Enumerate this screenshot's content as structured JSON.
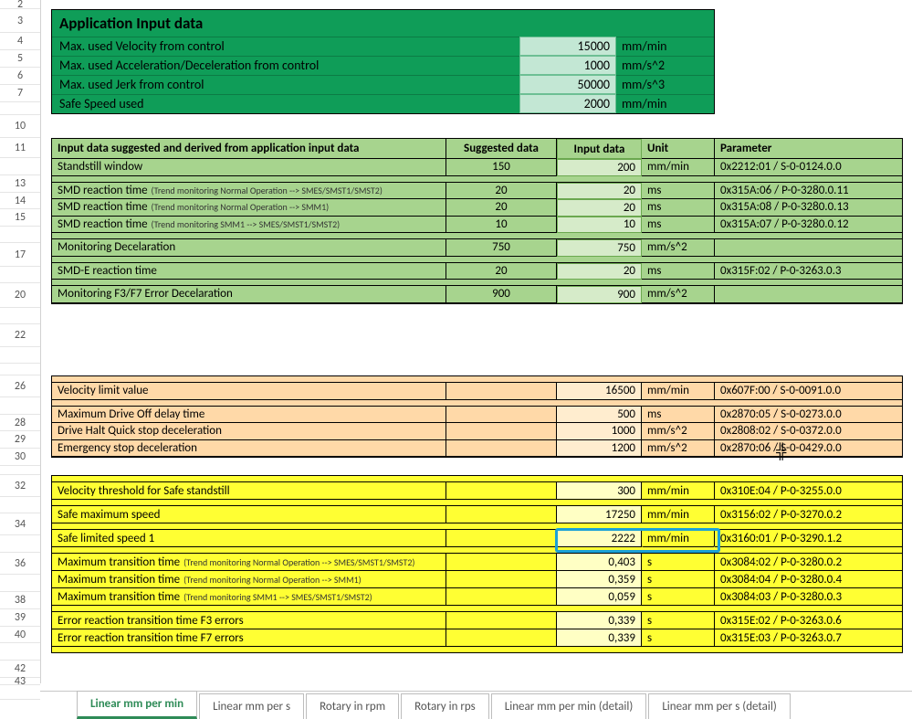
{
  "row_headers": [
    "2",
    "3",
    "4",
    "5",
    "6",
    "7",
    "",
    "10",
    "11",
    "",
    "13",
    "14",
    "15",
    "",
    "17",
    "",
    "20",
    "",
    "22",
    "",
    "",
    "26",
    "",
    "28",
    "29",
    "30",
    "",
    "32",
    "",
    "34",
    "",
    "36",
    "",
    "38",
    "39",
    "40",
    "",
    "42",
    "43",
    ""
  ],
  "app": {
    "title": "Application Input data",
    "rows": [
      {
        "label": "Max. used Velocity from control",
        "value": "15000",
        "unit": "mm/min"
      },
      {
        "label": "Max. used Acceleration/Deceleration from control",
        "value": "1000",
        "unit": "mm/s^2"
      },
      {
        "label": "Max. used Jerk from control",
        "value": "50000",
        "unit": "mm/s^3"
      },
      {
        "label": "Safe Speed used",
        "value": "2000",
        "unit": "mm/min"
      }
    ]
  },
  "green": {
    "headers": {
      "name": "Input data suggested and derived from application input data",
      "sugg": "Suggested data",
      "inp": "Input data",
      "unit": "Unit",
      "param": "Parameter"
    },
    "g1": [
      {
        "name": "Standstill window",
        "sugg": "150",
        "inp": "200",
        "unit": "mm/min",
        "param": "0x2212:01 / S-0-0124.0.0"
      }
    ],
    "g2": [
      {
        "name": "SMD reaction time",
        "note": "(Trend monitoring Normal Operation --> SMES/SMST1/SMST2)",
        "sugg": "20",
        "inp": "20",
        "unit": "ms",
        "param": "0x315A:06 / P-0-3280.0.11"
      },
      {
        "name": "SMD reaction time",
        "note": "(Trend monitoring Normal Operation --> SMM1)",
        "sugg": "20",
        "inp": "20",
        "unit": "ms",
        "param": "0x315A:08 / P-0-3280.0.13"
      },
      {
        "name": "SMD reaction time",
        "note": "(Trend monitoring SMM1 --> SMES/SMST1/SMST2)",
        "sugg": "10",
        "inp": "10",
        "unit": "ms",
        "param": "0x315A:07 / P-0-3280.0.12"
      }
    ],
    "g3": [
      {
        "name": "Monitoring Decelaration",
        "sugg": "750",
        "inp": "750",
        "unit": "mm/s^2",
        "param": ""
      }
    ],
    "g4": [
      {
        "name": "SMD-E reaction time",
        "sugg": "20",
        "inp": "20",
        "unit": "ms",
        "param": "0x315F:02 / P-0-3263.0.3"
      }
    ],
    "g5": [
      {
        "name": "Monitoring F3/F7 Error Decelaration",
        "sugg": "900",
        "inp": "900",
        "unit": "mm/s^2",
        "param": ""
      }
    ]
  },
  "orange": {
    "g1": [
      {
        "name": "Velocity limit value",
        "inp": "16500",
        "unit": "mm/min",
        "param": "0x607F:00 / S-0-0091.0.0"
      }
    ],
    "g2": [
      {
        "name": "Maximum Drive Off delay time",
        "inp": "500",
        "unit": "ms",
        "param": "0x2870:05 / S-0-0273.0.0"
      },
      {
        "name": "Drive Halt Quick stop deceleration",
        "inp": "1000",
        "unit": "mm/s^2",
        "param": "0x2808:02 / S-0-0372.0.0"
      },
      {
        "name": "Emergency stop deceleration",
        "inp": "1200",
        "unit": "mm/s^2",
        "param": "0x2870:06 / S-0-0429.0.0"
      }
    ]
  },
  "yellow": {
    "g1": [
      {
        "name": "Velocity threshold for Safe standstill",
        "inp": "300",
        "unit": "mm/min",
        "param": "0x310E:04 / P-0-3255.0.0"
      }
    ],
    "g2": [
      {
        "name": "Safe maximum speed",
        "inp": "17250",
        "unit": "mm/min",
        "param": "0x3156:02 / P-0-3270.0.2"
      }
    ],
    "g3": [
      {
        "name": "Safe limited speed 1",
        "inp": "2222",
        "unit": "mm/min",
        "param": "0x3160:01 / P-0-3290.1.2",
        "active": true
      }
    ],
    "g4": [
      {
        "name": "Maximum transition time",
        "note": "(Trend monitoring Normal Operation --> SMES/SMST1/SMST2)",
        "inp": "0,403",
        "unit": "s",
        "param": "0x3084:02 / P-0-3280.0.2"
      },
      {
        "name": "Maximum transition time",
        "note": "(Trend monitoring Normal Operation --> SMM1)",
        "inp": "0,359",
        "unit": "s",
        "param": "0x3084:04 / P-0-3280.0.4"
      },
      {
        "name": "Maximum transition time",
        "note": "(Trend monitoring SMM1 --> SMES/SMST1/SMST2)",
        "inp": "0,059",
        "unit": "s",
        "param": "0x3084:03 / P-0-3280.0.3"
      }
    ],
    "g5": [
      {
        "name": "Error reaction transition time F3 errors",
        "inp": "0,339",
        "unit": "s",
        "param": "0x315E:02 / P-0-3263.0.6"
      },
      {
        "name": "Error reaction transition time F7 errors",
        "inp": "0,339",
        "unit": "s",
        "param": "0x315E:03 / P-0-3263.0.7"
      }
    ]
  },
  "tabs": [
    "Linear mm per min",
    "Linear mm per s",
    "Rotary in rpm",
    "Rotary in rps",
    "Linear mm per min (detail)",
    "Linear mm per s (detail)"
  ],
  "active_tab": 0
}
